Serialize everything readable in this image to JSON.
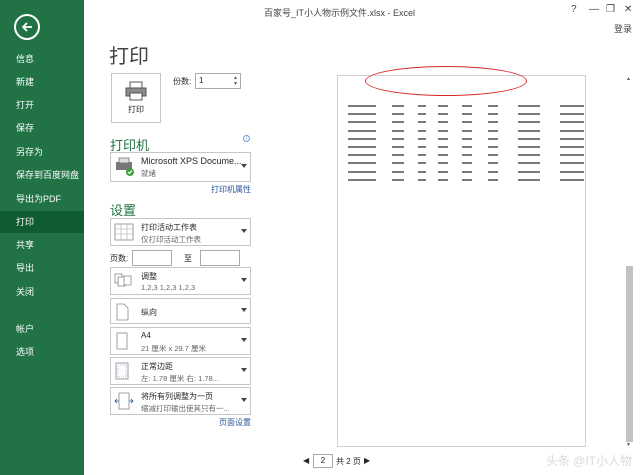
{
  "window": {
    "title": "百家号_IT小人物示例文件.xlsx - Excel",
    "help": "?",
    "minimize": "—",
    "restore": "❐",
    "close": "✕",
    "signin": "登录"
  },
  "sidebar": {
    "items": [
      {
        "label": "信息"
      },
      {
        "label": "新建"
      },
      {
        "label": "打开"
      },
      {
        "label": "保存"
      },
      {
        "label": "另存为"
      },
      {
        "label": "保存到百度网盘"
      },
      {
        "label": "导出为PDF"
      },
      {
        "label": "打印"
      },
      {
        "label": "共享"
      },
      {
        "label": "导出"
      },
      {
        "label": "关闭"
      },
      {
        "label": "帐户"
      },
      {
        "label": "选项"
      }
    ],
    "active_index": 7
  },
  "print": {
    "title": "打印",
    "button_label": "打印",
    "copies_label": "份数:",
    "copies_value": "1"
  },
  "printer": {
    "heading": "打印机",
    "name": "Microsoft XPS Docume...",
    "status": "就绪",
    "properties_link": "打印机属性"
  },
  "settings": {
    "heading": "设置",
    "scope_main": "打印活动工作表",
    "scope_sub": "仅打印活动工作表",
    "pages_label": "页数:",
    "pages_to": "至",
    "collate_main": "调整",
    "collate_sub": "1,2,3    1,2,3    1,2,3",
    "orientation": "纵向",
    "paper_main": "A4",
    "paper_sub": "21 厘米 x 29.7 厘米",
    "margin_main": "正常边距",
    "margin_sub": "左: 1.78 厘米    右: 1.78...",
    "scale_main": "将所有列调整为一页",
    "scale_sub": "缩减打印输出使其只有一...",
    "page_setup_link": "页面设置"
  },
  "preview": {
    "current_page": "2",
    "total_pages": "共 2 页",
    "watermark": "头条 @IT小人物",
    "rows": 10
  }
}
